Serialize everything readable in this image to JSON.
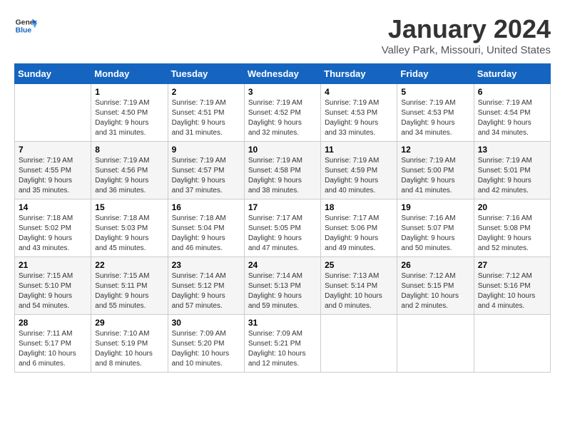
{
  "header": {
    "logo_general": "General",
    "logo_blue": "Blue",
    "month_title": "January 2024",
    "location": "Valley Park, Missouri, United States"
  },
  "weekdays": [
    "Sunday",
    "Monday",
    "Tuesday",
    "Wednesday",
    "Thursday",
    "Friday",
    "Saturday"
  ],
  "weeks": [
    [
      {
        "day": "",
        "info": ""
      },
      {
        "day": "1",
        "info": "Sunrise: 7:19 AM\nSunset: 4:50 PM\nDaylight: 9 hours\nand 31 minutes."
      },
      {
        "day": "2",
        "info": "Sunrise: 7:19 AM\nSunset: 4:51 PM\nDaylight: 9 hours\nand 31 minutes."
      },
      {
        "day": "3",
        "info": "Sunrise: 7:19 AM\nSunset: 4:52 PM\nDaylight: 9 hours\nand 32 minutes."
      },
      {
        "day": "4",
        "info": "Sunrise: 7:19 AM\nSunset: 4:53 PM\nDaylight: 9 hours\nand 33 minutes."
      },
      {
        "day": "5",
        "info": "Sunrise: 7:19 AM\nSunset: 4:53 PM\nDaylight: 9 hours\nand 34 minutes."
      },
      {
        "day": "6",
        "info": "Sunrise: 7:19 AM\nSunset: 4:54 PM\nDaylight: 9 hours\nand 34 minutes."
      }
    ],
    [
      {
        "day": "7",
        "info": "Sunrise: 7:19 AM\nSunset: 4:55 PM\nDaylight: 9 hours\nand 35 minutes."
      },
      {
        "day": "8",
        "info": "Sunrise: 7:19 AM\nSunset: 4:56 PM\nDaylight: 9 hours\nand 36 minutes."
      },
      {
        "day": "9",
        "info": "Sunrise: 7:19 AM\nSunset: 4:57 PM\nDaylight: 9 hours\nand 37 minutes."
      },
      {
        "day": "10",
        "info": "Sunrise: 7:19 AM\nSunset: 4:58 PM\nDaylight: 9 hours\nand 38 minutes."
      },
      {
        "day": "11",
        "info": "Sunrise: 7:19 AM\nSunset: 4:59 PM\nDaylight: 9 hours\nand 40 minutes."
      },
      {
        "day": "12",
        "info": "Sunrise: 7:19 AM\nSunset: 5:00 PM\nDaylight: 9 hours\nand 41 minutes."
      },
      {
        "day": "13",
        "info": "Sunrise: 7:19 AM\nSunset: 5:01 PM\nDaylight: 9 hours\nand 42 minutes."
      }
    ],
    [
      {
        "day": "14",
        "info": "Sunrise: 7:18 AM\nSunset: 5:02 PM\nDaylight: 9 hours\nand 43 minutes."
      },
      {
        "day": "15",
        "info": "Sunrise: 7:18 AM\nSunset: 5:03 PM\nDaylight: 9 hours\nand 45 minutes."
      },
      {
        "day": "16",
        "info": "Sunrise: 7:18 AM\nSunset: 5:04 PM\nDaylight: 9 hours\nand 46 minutes."
      },
      {
        "day": "17",
        "info": "Sunrise: 7:17 AM\nSunset: 5:05 PM\nDaylight: 9 hours\nand 47 minutes."
      },
      {
        "day": "18",
        "info": "Sunrise: 7:17 AM\nSunset: 5:06 PM\nDaylight: 9 hours\nand 49 minutes."
      },
      {
        "day": "19",
        "info": "Sunrise: 7:16 AM\nSunset: 5:07 PM\nDaylight: 9 hours\nand 50 minutes."
      },
      {
        "day": "20",
        "info": "Sunrise: 7:16 AM\nSunset: 5:08 PM\nDaylight: 9 hours\nand 52 minutes."
      }
    ],
    [
      {
        "day": "21",
        "info": "Sunrise: 7:15 AM\nSunset: 5:10 PM\nDaylight: 9 hours\nand 54 minutes."
      },
      {
        "day": "22",
        "info": "Sunrise: 7:15 AM\nSunset: 5:11 PM\nDaylight: 9 hours\nand 55 minutes."
      },
      {
        "day": "23",
        "info": "Sunrise: 7:14 AM\nSunset: 5:12 PM\nDaylight: 9 hours\nand 57 minutes."
      },
      {
        "day": "24",
        "info": "Sunrise: 7:14 AM\nSunset: 5:13 PM\nDaylight: 9 hours\nand 59 minutes."
      },
      {
        "day": "25",
        "info": "Sunrise: 7:13 AM\nSunset: 5:14 PM\nDaylight: 10 hours\nand 0 minutes."
      },
      {
        "day": "26",
        "info": "Sunrise: 7:12 AM\nSunset: 5:15 PM\nDaylight: 10 hours\nand 2 minutes."
      },
      {
        "day": "27",
        "info": "Sunrise: 7:12 AM\nSunset: 5:16 PM\nDaylight: 10 hours\nand 4 minutes."
      }
    ],
    [
      {
        "day": "28",
        "info": "Sunrise: 7:11 AM\nSunset: 5:17 PM\nDaylight: 10 hours\nand 6 minutes."
      },
      {
        "day": "29",
        "info": "Sunrise: 7:10 AM\nSunset: 5:19 PM\nDaylight: 10 hours\nand 8 minutes."
      },
      {
        "day": "30",
        "info": "Sunrise: 7:09 AM\nSunset: 5:20 PM\nDaylight: 10 hours\nand 10 minutes."
      },
      {
        "day": "31",
        "info": "Sunrise: 7:09 AM\nSunset: 5:21 PM\nDaylight: 10 hours\nand 12 minutes."
      },
      {
        "day": "",
        "info": ""
      },
      {
        "day": "",
        "info": ""
      },
      {
        "day": "",
        "info": ""
      }
    ]
  ]
}
